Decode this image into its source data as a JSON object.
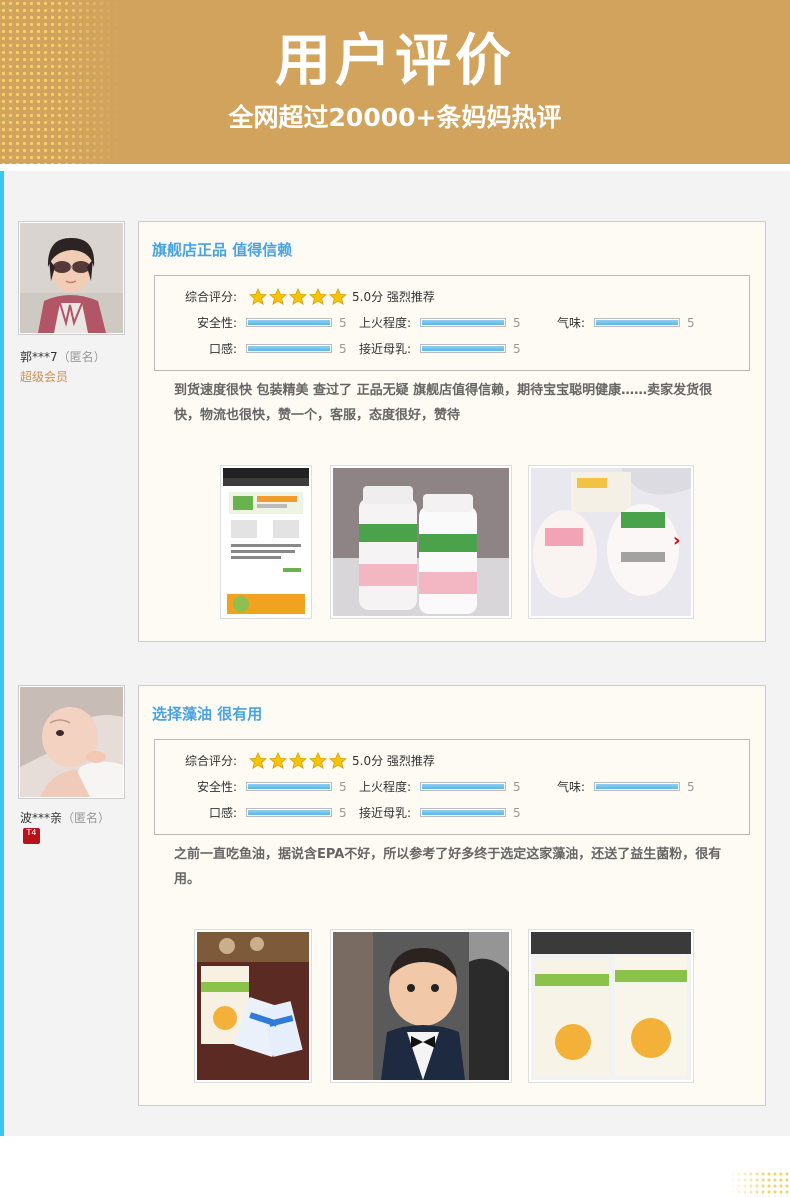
{
  "header": {
    "title": "用户评价",
    "subtitle": "全网超过20000+条妈妈热评"
  },
  "labels": {
    "overall": "综合评分:",
    "safety": "安全性:",
    "heat": "上火程度:",
    "smell": "气味:",
    "taste": "口感:",
    "breastmilk": "接近母乳:"
  },
  "reviews": [
    {
      "user": "郭***7",
      "anon": "（匿名）",
      "level": "超级会员",
      "title": "旗舰店正品 值得信赖",
      "score_text": "5.0分 强烈推荐",
      "stars": 5,
      "scores": {
        "safety": {
          "value": 5,
          "text": "5"
        },
        "heat": {
          "value": 5,
          "text": "5"
        },
        "smell": {
          "value": 5,
          "text": "5"
        },
        "taste": {
          "value": 5,
          "text": "5"
        },
        "breastmilk": {
          "value": 5,
          "text": "5"
        }
      },
      "text": "到货速度很快 包装精美 查过了 正品无疑 旗舰店值得信赖，期待宝宝聪明健康……卖家发货很快，物流也很快，赞一个，客服，态度很好，赞待",
      "photos": [
        "phone-screenshot-photo",
        "dha-bottles-photo",
        "dha-bottle-caps-photo"
      ]
    },
    {
      "user": "波***亲",
      "anon": "（匿名）",
      "badge": "T4",
      "title": "选择藻油 很有用",
      "score_text": "5.0分 强烈推荐",
      "stars": 5,
      "scores": {
        "safety": {
          "value": 5,
          "text": "5"
        },
        "heat": {
          "value": 5,
          "text": "5"
        },
        "smell": {
          "value": 5,
          "text": "5"
        },
        "taste": {
          "value": 5,
          "text": "5"
        },
        "breastmilk": {
          "value": 5,
          "text": "5"
        }
      },
      "text": "之前一直吃鱼油，据说含EPA不好，所以参考了好多终于选定这家藻油，还送了益生菌粉，很有用。",
      "photos": [
        "dha-box-sachets-photo",
        "baby-bowtie-photo",
        "dha-boxes-photo"
      ]
    }
  ],
  "colors": {
    "banner": "#d1a35c",
    "accent_blue": "#4aa3e0",
    "left_line": "#39c6f3",
    "member_gold": "#c8915b",
    "star": "#f6c20a",
    "bar_fill": "#5ab6e9"
  }
}
